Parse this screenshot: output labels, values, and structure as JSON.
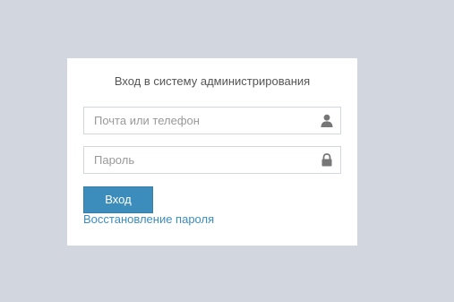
{
  "login": {
    "title": "Вход в систему администрирования",
    "email_placeholder": "Почта или телефон",
    "email_icon": "user-icon",
    "password_placeholder": "Пароль",
    "password_icon": "lock-icon",
    "submit_label": "Вход",
    "forgot_link": "Восстановление пароля"
  },
  "colors": {
    "background": "#d2d6de",
    "panel": "#ffffff",
    "accent": "#3c8dbc",
    "icon": "#777777"
  }
}
